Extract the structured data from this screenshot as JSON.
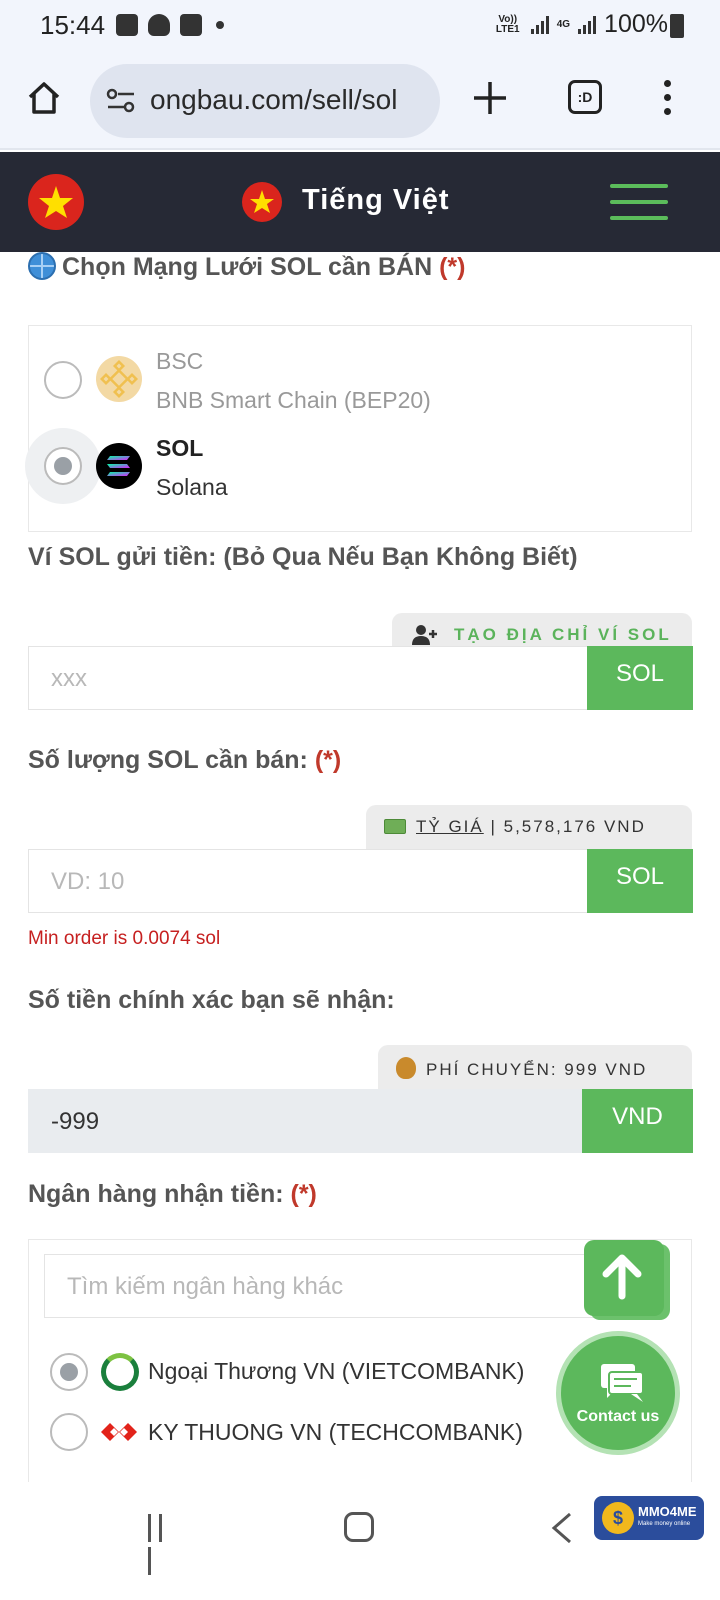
{
  "status_bar": {
    "time": "15:44",
    "network_label": "Vo)) LTE1",
    "net_type": "4G",
    "battery": "100%"
  },
  "browser": {
    "url": "ongbau.com/sell/sol",
    "tabs_label": ":D"
  },
  "header": {
    "language": "Tiếng Việt"
  },
  "network_section": {
    "label": "Chọn Mạng Lưới SOL cần BÁN",
    "required_mark": "(*)",
    "options": [
      {
        "name": "BSC",
        "subtitle": "BNB Smart Chain (BEP20)",
        "selected": false,
        "icon": "bnb-icon"
      },
      {
        "name": "SOL",
        "subtitle": "Solana",
        "selected": true,
        "icon": "solana-icon"
      }
    ]
  },
  "wallet_section": {
    "label": "Ví SOL gửi tiền: (Bỏ Qua Nếu Bạn Không Biết)",
    "create_button": "TẠO ĐỊA CHỈ VÍ SOL",
    "placeholder": "xxx",
    "addon": "SOL"
  },
  "amount_section": {
    "label": "Số lượng SOL cần bán:",
    "required_mark": "(*)",
    "rate_link": "TỶ GIÁ",
    "rate_value": "| 5,578,176 VND",
    "placeholder": "VD: 10",
    "addon": "SOL",
    "error": "Min order is 0.0074 sol"
  },
  "receive_section": {
    "label": "Số tiền chính xác bạn sẽ nhận:",
    "fee_text": "PHÍ CHUYỂN: 999 VND",
    "value": "-999",
    "addon": "VND"
  },
  "bank_section": {
    "label": "Ngân hàng nhận tiền:",
    "required_mark": "(*)",
    "search_placeholder": "Tìm kiếm ngân hàng khác",
    "banks": [
      {
        "name": "Ngoại Thương VN (VIETCOMBANK)",
        "selected": true
      },
      {
        "name": "KY THUONG VN (TECHCOMBANK)",
        "selected": false
      }
    ]
  },
  "floating": {
    "contact_label": "Contact us"
  },
  "watermark": {
    "brand": "MMO4ME",
    "tagline": "Make money online"
  },
  "colors": {
    "accent_green": "#5cb85c",
    "header_dark": "#262935",
    "required_red": "#c0392b",
    "error_red": "#c62020"
  }
}
